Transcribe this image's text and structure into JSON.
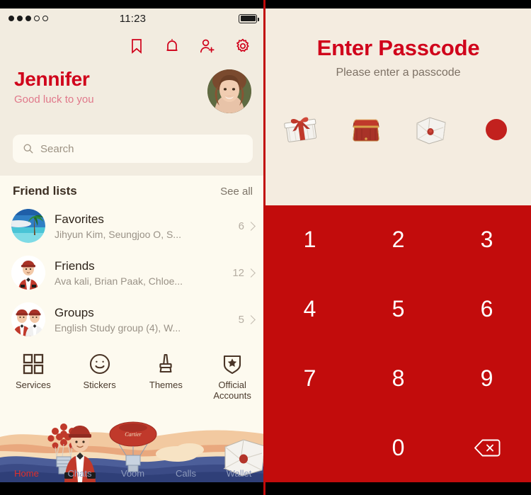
{
  "statusbar": {
    "signal_dots_filled": 3,
    "signal_dots_total": 5,
    "time": "11:23",
    "battery_icon": "battery-full-icon"
  },
  "left_panel": {
    "header_icons": [
      {
        "name": "bookmark-icon",
        "label": "Bookmark"
      },
      {
        "name": "bell-icon",
        "label": "Notifications"
      },
      {
        "name": "add-friend-icon",
        "label": "Add Friend"
      },
      {
        "name": "gear-icon",
        "label": "Settings"
      }
    ],
    "profile": {
      "name": "Jennifer",
      "status_message": "Good luck to you",
      "avatar": "user-avatar"
    },
    "search": {
      "placeholder": "Search",
      "value": "",
      "icon": "search-icon"
    },
    "friend_lists": {
      "title": "Friend lists",
      "see_all": "See all",
      "rows": [
        {
          "name": "Favorites",
          "members": "Jihyun Kim, Seungjoo O, S...",
          "count": "6",
          "thumb": "beach-photo"
        },
        {
          "name": "Friends",
          "members": "Ava kali, Brian Paak, Chloe...",
          "count": "12",
          "thumb": "bellhop-avatar"
        },
        {
          "name": "Groups",
          "members": "English Study group (4), W...",
          "count": "5",
          "thumb": "two-bellhops-avatar"
        }
      ]
    },
    "quick_actions": [
      {
        "label": "Services",
        "icon": "grid-icon"
      },
      {
        "label": "Stickers",
        "icon": "smiley-icon"
      },
      {
        "label": "Themes",
        "icon": "brush-icon"
      },
      {
        "label": "Official\nAccounts",
        "icon": "shield-star-icon"
      }
    ],
    "tabbar": [
      {
        "label": "Home",
        "active": true
      },
      {
        "label": "Chats",
        "active": false
      },
      {
        "label": "Voom",
        "active": false
      },
      {
        "label": "Calls",
        "active": false
      },
      {
        "label": "Wallet",
        "active": false
      }
    ]
  },
  "right_panel": {
    "title": "Enter Passcode",
    "subtitle": "Please enter a passcode",
    "passcode_slots": [
      {
        "icon": "gift-box-icon",
        "filled": false
      },
      {
        "icon": "jewelry-box-icon",
        "filled": false
      },
      {
        "icon": "sealed-envelope-icon",
        "filled": false
      },
      {
        "icon": "filled-dot-icon",
        "filled": true
      }
    ],
    "keypad": [
      {
        "key": "1"
      },
      {
        "key": "2"
      },
      {
        "key": "3"
      },
      {
        "key": "4"
      },
      {
        "key": "5"
      },
      {
        "key": "6"
      },
      {
        "key": "7"
      },
      {
        "key": "8"
      },
      {
        "key": "9"
      },
      {
        "key": ""
      },
      {
        "key": "0"
      },
      {
        "key": "backspace-icon"
      }
    ]
  },
  "colors": {
    "brand_red": "#d0021b",
    "keypad_red": "#c20c0c",
    "cream": "#f2ece0",
    "list_bg": "#fdfaef",
    "muted": "#9a9287",
    "tab_inactive": "#8e9bbd",
    "tab_active": "#e0312d"
  }
}
